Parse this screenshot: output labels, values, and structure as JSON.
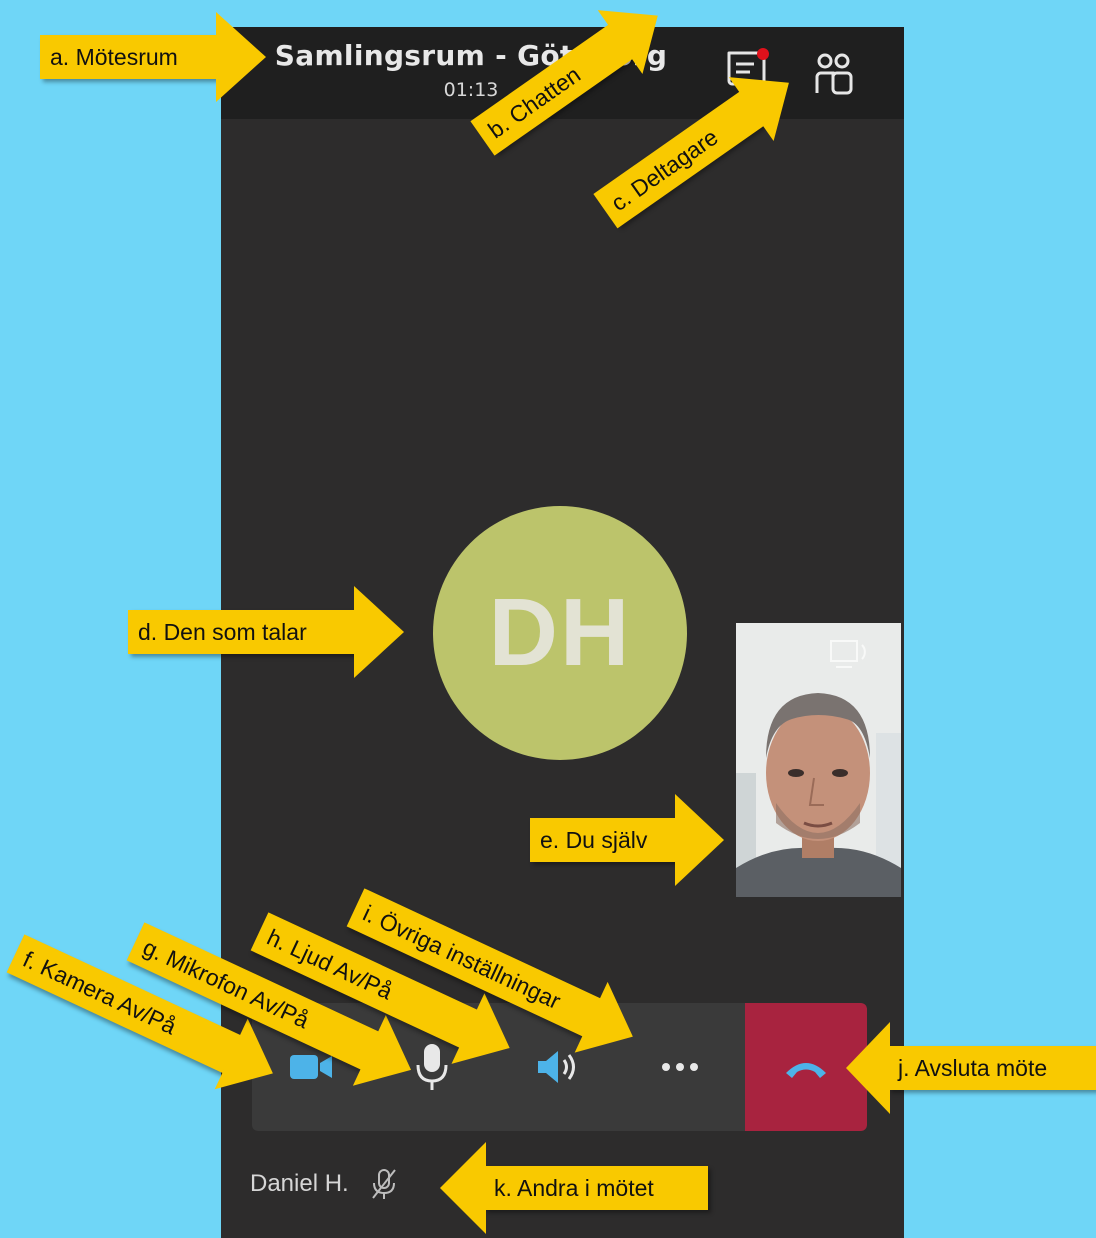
{
  "meeting": {
    "room_title": "Samlingsrum - Göteborg",
    "elapsed": "01:13",
    "speaker_initials": "DH",
    "participant_name": "Daniel H."
  },
  "toolbar": {
    "chat_icon": "chat-icon",
    "participants_icon": "participants-icon",
    "camera_icon": "camera-icon",
    "mic_icon": "microphone-icon",
    "speaker_icon": "speaker-icon",
    "more_icon": "more-options-icon",
    "hangup_icon": "hang-up-icon"
  },
  "annotations": {
    "a": "a. Mötesrum",
    "b": "b. Chatten",
    "c": "c. Deltagare",
    "d": "d. Den som talar",
    "e": "e. Du själv",
    "f": "f. Kamera Av/På",
    "g": "g. Mikrofon Av/På",
    "h": "h. Ljud Av/På",
    "i": "i. Övriga inställningar",
    "j": "j. Avsluta möte",
    "k": "k. Andra i mötet"
  },
  "colors": {
    "background": "#6fd6f7",
    "app_dark": "#2d2c2c",
    "avatar": "#bcc46b",
    "hangup": "#a8233f",
    "icon_blue": "#4db3e8",
    "callout": "#f9c900",
    "chat_badge": "#e0111b"
  }
}
